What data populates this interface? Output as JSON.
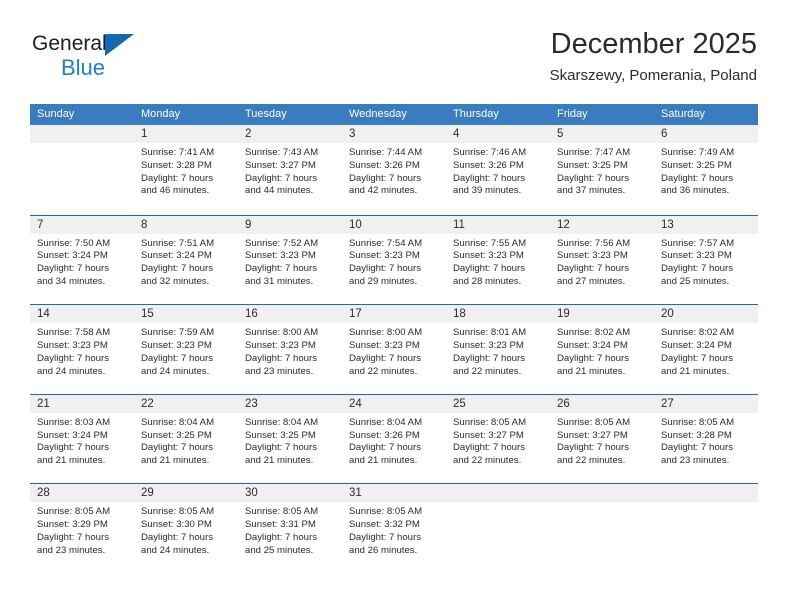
{
  "brand": {
    "name_top": "General",
    "name_bottom": "Blue",
    "triangle_color": "#1667b4",
    "blue_color": "#1f7fd0"
  },
  "header": {
    "title": "December 2025",
    "subtitle": "Skarszewy, Pomerania, Poland"
  },
  "colors": {
    "header_bar": "#3a7cc0",
    "row_divider": "#1f69b3",
    "daynum_band": "#f0f0f0",
    "text": "#2b2b2b"
  },
  "weekdays": [
    "Sunday",
    "Monday",
    "Tuesday",
    "Wednesday",
    "Thursday",
    "Friday",
    "Saturday"
  ],
  "weeks": [
    [
      {
        "day": "",
        "sunrise": "",
        "sunset": "",
        "daylight_1": "",
        "daylight_2": ""
      },
      {
        "day": "1",
        "sunrise": "Sunrise: 7:41 AM",
        "sunset": "Sunset: 3:28 PM",
        "daylight_1": "Daylight: 7 hours",
        "daylight_2": "and 46 minutes."
      },
      {
        "day": "2",
        "sunrise": "Sunrise: 7:43 AM",
        "sunset": "Sunset: 3:27 PM",
        "daylight_1": "Daylight: 7 hours",
        "daylight_2": "and 44 minutes."
      },
      {
        "day": "3",
        "sunrise": "Sunrise: 7:44 AM",
        "sunset": "Sunset: 3:26 PM",
        "daylight_1": "Daylight: 7 hours",
        "daylight_2": "and 42 minutes."
      },
      {
        "day": "4",
        "sunrise": "Sunrise: 7:46 AM",
        "sunset": "Sunset: 3:26 PM",
        "daylight_1": "Daylight: 7 hours",
        "daylight_2": "and 39 minutes."
      },
      {
        "day": "5",
        "sunrise": "Sunrise: 7:47 AM",
        "sunset": "Sunset: 3:25 PM",
        "daylight_1": "Daylight: 7 hours",
        "daylight_2": "and 37 minutes."
      },
      {
        "day": "6",
        "sunrise": "Sunrise: 7:49 AM",
        "sunset": "Sunset: 3:25 PM",
        "daylight_1": "Daylight: 7 hours",
        "daylight_2": "and 36 minutes."
      }
    ],
    [
      {
        "day": "7",
        "sunrise": "Sunrise: 7:50 AM",
        "sunset": "Sunset: 3:24 PM",
        "daylight_1": "Daylight: 7 hours",
        "daylight_2": "and 34 minutes."
      },
      {
        "day": "8",
        "sunrise": "Sunrise: 7:51 AM",
        "sunset": "Sunset: 3:24 PM",
        "daylight_1": "Daylight: 7 hours",
        "daylight_2": "and 32 minutes."
      },
      {
        "day": "9",
        "sunrise": "Sunrise: 7:52 AM",
        "sunset": "Sunset: 3:23 PM",
        "daylight_1": "Daylight: 7 hours",
        "daylight_2": "and 31 minutes."
      },
      {
        "day": "10",
        "sunrise": "Sunrise: 7:54 AM",
        "sunset": "Sunset: 3:23 PM",
        "daylight_1": "Daylight: 7 hours",
        "daylight_2": "and 29 minutes."
      },
      {
        "day": "11",
        "sunrise": "Sunrise: 7:55 AM",
        "sunset": "Sunset: 3:23 PM",
        "daylight_1": "Daylight: 7 hours",
        "daylight_2": "and 28 minutes."
      },
      {
        "day": "12",
        "sunrise": "Sunrise: 7:56 AM",
        "sunset": "Sunset: 3:23 PM",
        "daylight_1": "Daylight: 7 hours",
        "daylight_2": "and 27 minutes."
      },
      {
        "day": "13",
        "sunrise": "Sunrise: 7:57 AM",
        "sunset": "Sunset: 3:23 PM",
        "daylight_1": "Daylight: 7 hours",
        "daylight_2": "and 25 minutes."
      }
    ],
    [
      {
        "day": "14",
        "sunrise": "Sunrise: 7:58 AM",
        "sunset": "Sunset: 3:23 PM",
        "daylight_1": "Daylight: 7 hours",
        "daylight_2": "and 24 minutes."
      },
      {
        "day": "15",
        "sunrise": "Sunrise: 7:59 AM",
        "sunset": "Sunset: 3:23 PM",
        "daylight_1": "Daylight: 7 hours",
        "daylight_2": "and 24 minutes."
      },
      {
        "day": "16",
        "sunrise": "Sunrise: 8:00 AM",
        "sunset": "Sunset: 3:23 PM",
        "daylight_1": "Daylight: 7 hours",
        "daylight_2": "and 23 minutes."
      },
      {
        "day": "17",
        "sunrise": "Sunrise: 8:00 AM",
        "sunset": "Sunset: 3:23 PM",
        "daylight_1": "Daylight: 7 hours",
        "daylight_2": "and 22 minutes."
      },
      {
        "day": "18",
        "sunrise": "Sunrise: 8:01 AM",
        "sunset": "Sunset: 3:23 PM",
        "daylight_1": "Daylight: 7 hours",
        "daylight_2": "and 22 minutes."
      },
      {
        "day": "19",
        "sunrise": "Sunrise: 8:02 AM",
        "sunset": "Sunset: 3:24 PM",
        "daylight_1": "Daylight: 7 hours",
        "daylight_2": "and 21 minutes."
      },
      {
        "day": "20",
        "sunrise": "Sunrise: 8:02 AM",
        "sunset": "Sunset: 3:24 PM",
        "daylight_1": "Daylight: 7 hours",
        "daylight_2": "and 21 minutes."
      }
    ],
    [
      {
        "day": "21",
        "sunrise": "Sunrise: 8:03 AM",
        "sunset": "Sunset: 3:24 PM",
        "daylight_1": "Daylight: 7 hours",
        "daylight_2": "and 21 minutes."
      },
      {
        "day": "22",
        "sunrise": "Sunrise: 8:04 AM",
        "sunset": "Sunset: 3:25 PM",
        "daylight_1": "Daylight: 7 hours",
        "daylight_2": "and 21 minutes."
      },
      {
        "day": "23",
        "sunrise": "Sunrise: 8:04 AM",
        "sunset": "Sunset: 3:25 PM",
        "daylight_1": "Daylight: 7 hours",
        "daylight_2": "and 21 minutes."
      },
      {
        "day": "24",
        "sunrise": "Sunrise: 8:04 AM",
        "sunset": "Sunset: 3:26 PM",
        "daylight_1": "Daylight: 7 hours",
        "daylight_2": "and 21 minutes."
      },
      {
        "day": "25",
        "sunrise": "Sunrise: 8:05 AM",
        "sunset": "Sunset: 3:27 PM",
        "daylight_1": "Daylight: 7 hours",
        "daylight_2": "and 22 minutes."
      },
      {
        "day": "26",
        "sunrise": "Sunrise: 8:05 AM",
        "sunset": "Sunset: 3:27 PM",
        "daylight_1": "Daylight: 7 hours",
        "daylight_2": "and 22 minutes."
      },
      {
        "day": "27",
        "sunrise": "Sunrise: 8:05 AM",
        "sunset": "Sunset: 3:28 PM",
        "daylight_1": "Daylight: 7 hours",
        "daylight_2": "and 23 minutes."
      }
    ],
    [
      {
        "day": "28",
        "sunrise": "Sunrise: 8:05 AM",
        "sunset": "Sunset: 3:29 PM",
        "daylight_1": "Daylight: 7 hours",
        "daylight_2": "and 23 minutes."
      },
      {
        "day": "29",
        "sunrise": "Sunrise: 8:05 AM",
        "sunset": "Sunset: 3:30 PM",
        "daylight_1": "Daylight: 7 hours",
        "daylight_2": "and 24 minutes."
      },
      {
        "day": "30",
        "sunrise": "Sunrise: 8:05 AM",
        "sunset": "Sunset: 3:31 PM",
        "daylight_1": "Daylight: 7 hours",
        "daylight_2": "and 25 minutes."
      },
      {
        "day": "31",
        "sunrise": "Sunrise: 8:05 AM",
        "sunset": "Sunset: 3:32 PM",
        "daylight_1": "Daylight: 7 hours",
        "daylight_2": "and 26 minutes."
      },
      {
        "day": "",
        "sunrise": "",
        "sunset": "",
        "daylight_1": "",
        "daylight_2": ""
      },
      {
        "day": "",
        "sunrise": "",
        "sunset": "",
        "daylight_1": "",
        "daylight_2": ""
      },
      {
        "day": "",
        "sunrise": "",
        "sunset": "",
        "daylight_1": "",
        "daylight_2": ""
      }
    ]
  ]
}
